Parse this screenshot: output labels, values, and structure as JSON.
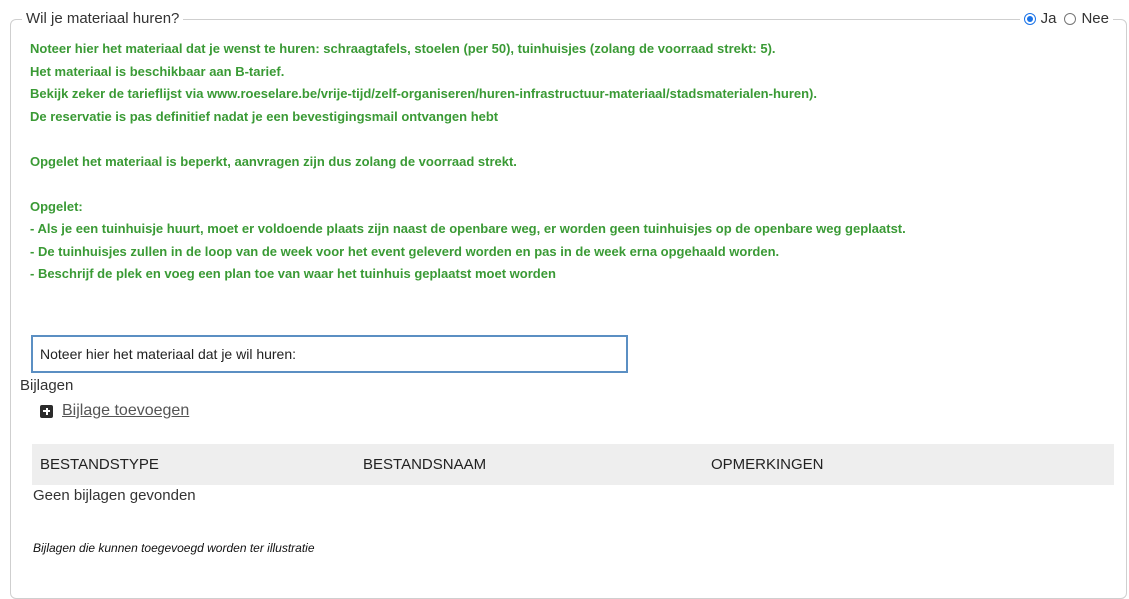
{
  "section": {
    "legend": "Wil je materiaal huren?",
    "options": [
      {
        "label": "Ja",
        "selected": true
      },
      {
        "label": "Nee",
        "selected": false
      }
    ]
  },
  "info": {
    "line1": "Noteer hier het materiaal dat je wenst te huren: schraagtafels, stoelen (per 50), tuinhuisjes (zolang de voorraad strekt: 5).",
    "line2": "Het materiaal is beschikbaar aan B-tarief.",
    "line3": "Bekijk zeker de tarieflijst via www.roeselare.be/vrije-tijd/zelf-organiseren/huren-infrastructuur-materiaal/stadsmaterialen-huren).",
    "line4": "De reservatie is pas definitief nadat je een bevestigingsmail ontvangen hebt",
    "line5": "Opgelet het materiaal is beperkt, aanvragen zijn dus zolang de voorraad strekt.",
    "line6": "Opgelet:",
    "line7": "- Als je een tuinhuisje huurt, moet er voldoende plaats zijn naast de openbare weg, er worden geen tuinhuisjes op de openbare weg geplaatst.",
    "line8": "- De tuinhuisjes zullen in de loop van de week voor het event geleverd worden en pas in de week erna opgehaald worden.",
    "line9": "- Beschrijf de plek en voeg een plan toe van waar het tuinhuis geplaatst moet worden",
    "color": "#3a9a35"
  },
  "material_input": {
    "value": "Noteer hier het materiaal dat je wil huren:"
  },
  "attachments": {
    "label": "Bijlagen",
    "add_label": "Bijlage toevoegen",
    "columns": [
      "BESTANDSTYPE",
      "BESTANDSNAAM",
      "OPMERKINGEN"
    ],
    "empty_message": "Geen bijlagen gevonden",
    "note": "Bijlagen die kunnen toegevoegd worden ter illustratie"
  },
  "colors": {
    "accent": "#1a73e8",
    "input_border": "#5b8fc3",
    "table_header_bg": "#eeeeee"
  }
}
